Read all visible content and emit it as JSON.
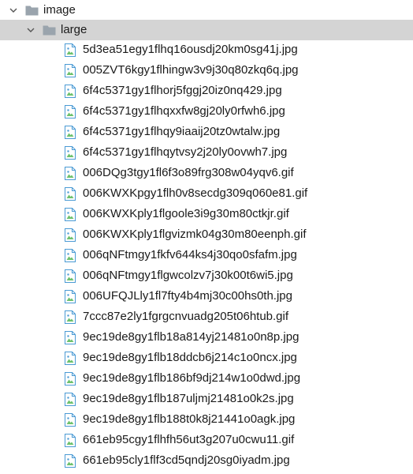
{
  "tree": {
    "root": {
      "label": "image",
      "icon": "folder-icon",
      "expanded": true
    },
    "child": {
      "label": "large",
      "icon": "folder-icon",
      "expanded": true,
      "selected": true
    },
    "files": [
      "5d3ea51egy1flhq16ousdj20km0sg41j.jpg",
      "005ZVT6kgy1flhingw3v9j30q80zkq6q.jpg",
      "6f4c5371gy1flhorj5fggj20iz0nq429.jpg",
      "6f4c5371gy1flhqxxfw8gj20ly0rfwh6.jpg",
      "6f4c5371gy1flhqy9iaaij20tz0wtalw.jpg",
      "6f4c5371gy1flhqytvsy2j20ly0ovwh7.jpg",
      "006DQg3tgy1fl6f3o89frg308w04yqv6.gif",
      "006KWXKpgy1flh0v8secdg309q060e81.gif",
      "006KWXKply1flgoole3i9g30m80ctkjr.gif",
      "006KWXKply1flgvizmk04g30m80eenph.gif",
      "006qNFtmgy1fkfv644ks4j30qo0sfafm.jpg",
      "006qNFtmgy1flgwcolzv7j30k00t6wi5.jpg",
      "006UFQJLly1fl7fty4b4mj30c00hs0th.jpg",
      "7ccc87e2ly1fgrgcnvuadg205t06htub.gif",
      "9ec19de8gy1flb18a814yj21481o0n8p.jpg",
      "9ec19de8gy1flb18ddcb6j214c1o0ncx.jpg",
      "9ec19de8gy1flb186bf9dj214w1o0dwd.jpg",
      "9ec19de8gy1flb187uljmj21481o0k2s.jpg",
      "9ec19de8gy1flb188t0k8j21441o0agk.jpg",
      "661eb95cgy1flhfh56ut3g207u0cwu11.gif",
      "661eb95cly1flf3cd5qndj20sg0iyadm.jpg"
    ],
    "file_icon": "image-file-icon",
    "colors": {
      "selection": "#d4d4d4",
      "folder": "#9aa4ad",
      "file_outline": "#4a9ad4",
      "file_image": "#6cc16c"
    }
  }
}
